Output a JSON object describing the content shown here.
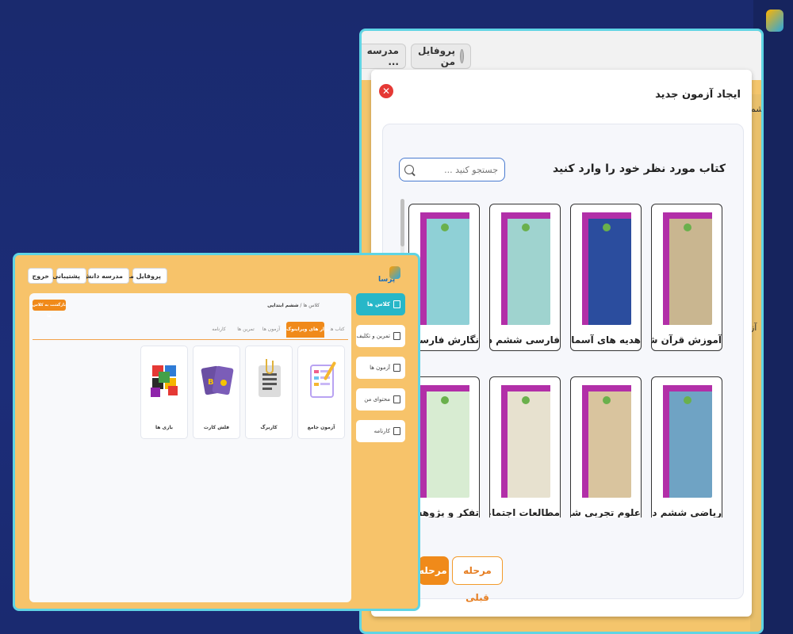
{
  "large_window": {
    "header": {
      "profile_label": "پروفایل من",
      "school_label": "مدرسه ..."
    },
    "edge_texts": [
      "شم",
      "آز"
    ],
    "modal": {
      "title": "ایجاد آزمون جدید",
      "prompt": "کتاب مورد نظر خود را وارد کنید",
      "search_placeholder": "جستجو کنید ...",
      "books": [
        {
          "label": "آموزش قرآن ششم دبستان",
          "cover": "#c9b690"
        },
        {
          "label": "هدیه های آسمان ششم دبستان",
          "cover": "#2b4d9e"
        },
        {
          "label": "فارسی ششم دبستان",
          "cover": "#9fd3cf"
        },
        {
          "label": "نگارش فارسی ششم دبستان",
          "cover": "#8fd0d6"
        },
        {
          "label": "ریاضی ششم دبستان",
          "cover": "#6fa3c4"
        },
        {
          "label": "علوم تجربی ششم دبستان",
          "cover": "#d9c49e"
        },
        {
          "label": "مطالعات اجتماعی ششم دبستان",
          "cover": "#e7e1cf"
        },
        {
          "label": "تفکر و پژوهش ششم دبستان",
          "cover": "#d8ecd2"
        }
      ],
      "prev_button": "مرحله قبلی",
      "next_button": "مرحله بعدی"
    }
  },
  "small_window": {
    "logo_text": "پرسا",
    "header": {
      "profile_label": "پروفایل من",
      "school_label": "مدرسه دانش",
      "support_label": "پشتیبانی",
      "logout_label": "خروج"
    },
    "nav": [
      {
        "label": "کلاس ها",
        "active": true
      },
      {
        "label": "تمرین و تکلیف",
        "active": false
      },
      {
        "label": "آزمون ها",
        "active": false
      },
      {
        "label": "محتوای من",
        "active": false
      },
      {
        "label": "کارنامه",
        "active": false
      }
    ],
    "breadcrumb": {
      "root": "کلاس ها",
      "current": "ششم ابتدایی"
    },
    "back_button": "بازگشت به کلاس ها",
    "tabs": [
      "کتاب ها",
      "ابزار های ویراینوک",
      "آزمون ها",
      "تمرین ها",
      "کارنامه"
    ],
    "active_tab": "ابزار های ویراینوک",
    "tools": [
      {
        "label": "آزمون جامع",
        "icon": "exam-icon"
      },
      {
        "label": "کاربرگ",
        "icon": "worksheet-icon"
      },
      {
        "label": "فلش کارت",
        "icon": "flashcard-icon"
      },
      {
        "label": "بازی ها",
        "icon": "puzzle-icon"
      }
    ]
  },
  "colors": {
    "background": "#1b2a72",
    "window_border": "#5fd4e4",
    "accent_orange": "#f08a1a",
    "teal_active": "#27b7c8",
    "book_spine": "#b22fa8"
  }
}
